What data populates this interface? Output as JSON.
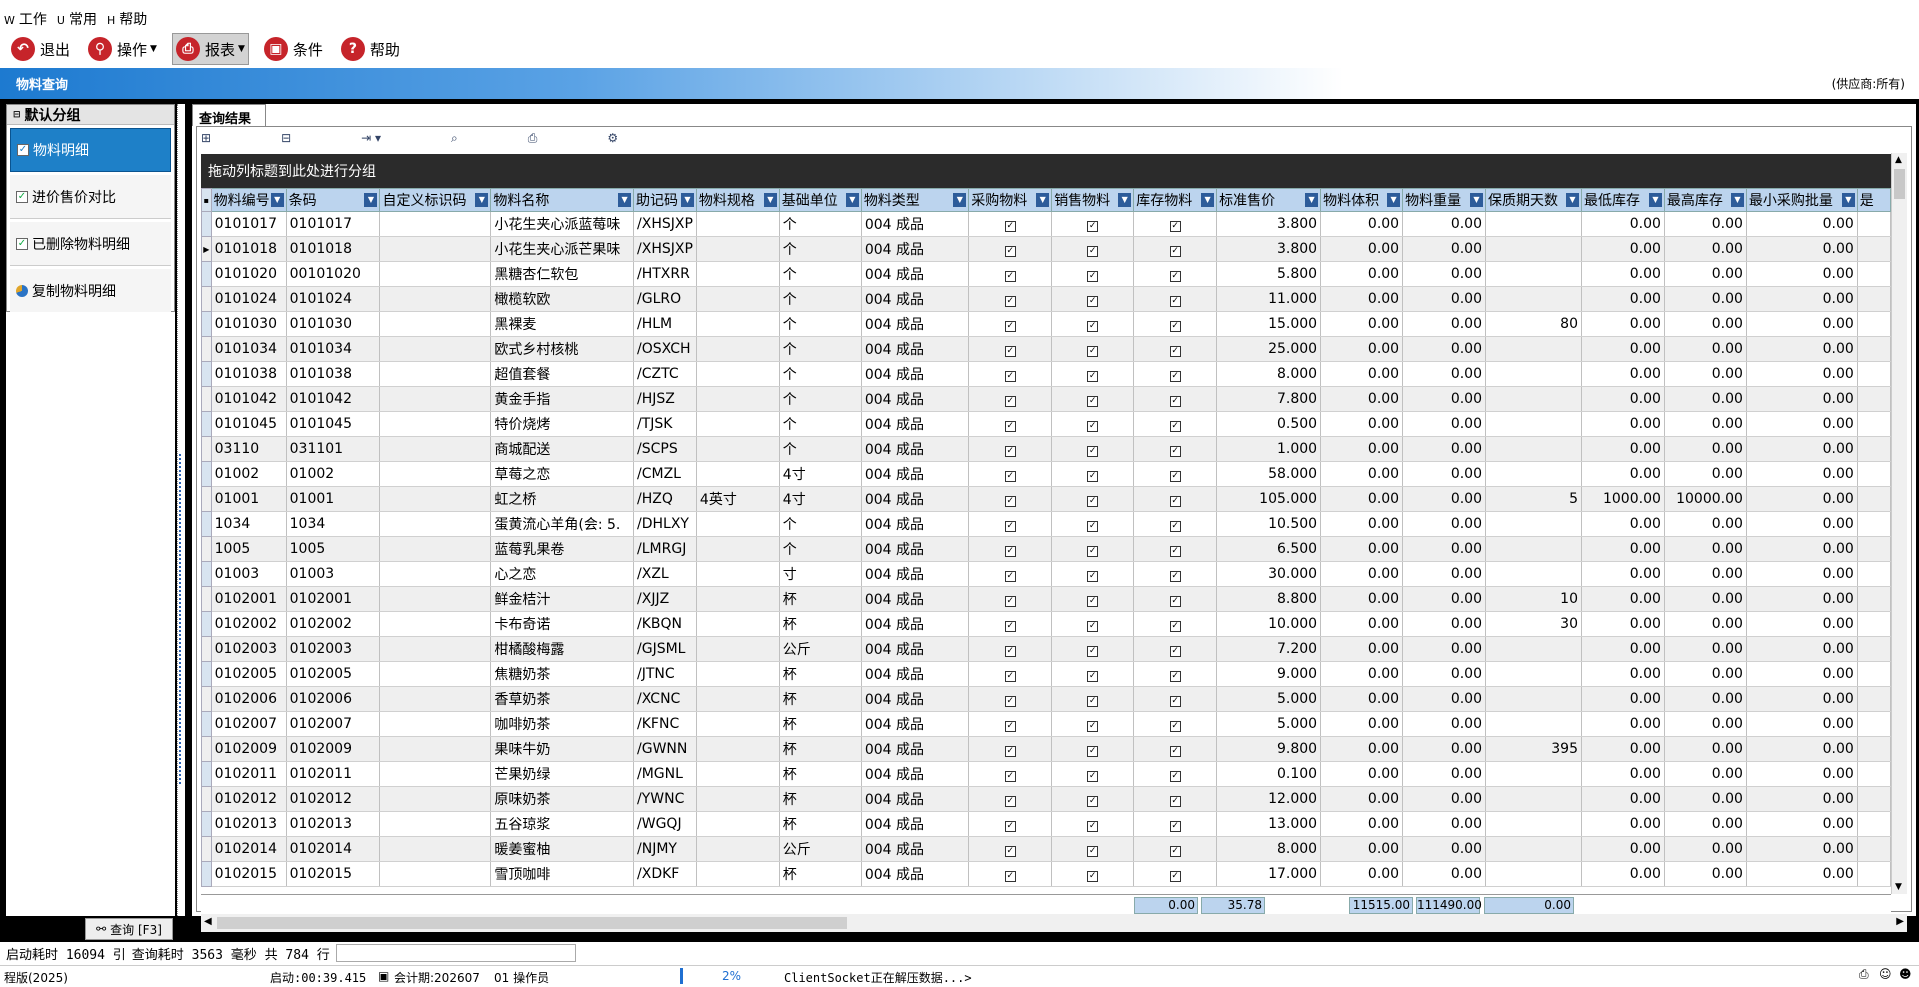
{
  "menu": {
    "items": [
      {
        "acc": "W",
        "label": "工作"
      },
      {
        "acc": "U",
        "label": "常用"
      },
      {
        "acc": "H",
        "label": "帮助"
      }
    ]
  },
  "toolbar": {
    "exit": "退出",
    "ops": "操作",
    "report": "报表",
    "cond": "条件",
    "help": "帮助"
  },
  "window": {
    "title": "物料查询",
    "supplier": "(供应商:所有)"
  },
  "left": {
    "header": "默认分组",
    "items": [
      "物料明细",
      "进价售价对比",
      "已删除物料明细",
      "复制物料明细"
    ],
    "query_button": "查询 [F3]"
  },
  "tab": "查询结果",
  "grid": {
    "group_hint": "拖动列标题到此处进行分组",
    "columns": [
      "物料编号",
      "条码",
      "自定义标识码",
      "物料名称",
      "助记码",
      "物料规格",
      "基础单位",
      "物料类型",
      "采购物料",
      "销售物料",
      "库存物料",
      "标准售价",
      "物料体积",
      "物料重量",
      "保质期天数",
      "最低库存",
      "最高库存",
      "最小采购批量",
      "是"
    ],
    "rows": [
      [
        "0101017",
        "0101017",
        "",
        "小花生夹心派蓝莓味",
        "/XHSJXP",
        "",
        "个",
        "004 成品",
        "3.800",
        "0.00",
        "0.00",
        "",
        "0.00",
        "0.00",
        "0.00"
      ],
      [
        "0101018",
        "0101018",
        "",
        "小花生夹心派芒果味",
        "/XHSJXP",
        "",
        "个",
        "004 成品",
        "3.800",
        "0.00",
        "0.00",
        "",
        "0.00",
        "0.00",
        "0.00"
      ],
      [
        "0101020",
        "00101020",
        "",
        "黑糖杏仁软包",
        "/HTXRR",
        "",
        "个",
        "004 成品",
        "5.800",
        "0.00",
        "0.00",
        "",
        "0.00",
        "0.00",
        "0.00"
      ],
      [
        "0101024",
        "0101024",
        "",
        "橄榄软欧",
        "/GLRO",
        "",
        "个",
        "004 成品",
        "11.000",
        "0.00",
        "0.00",
        "",
        "0.00",
        "0.00",
        "0.00"
      ],
      [
        "0101030",
        "0101030",
        "",
        "黑裸麦",
        "/HLM",
        "",
        "个",
        "004 成品",
        "15.000",
        "0.00",
        "0.00",
        "80",
        "0.00",
        "0.00",
        "0.00"
      ],
      [
        "0101034",
        "0101034",
        "",
        "欧式乡村核桃",
        "/OSXCH",
        "",
        "个",
        "004 成品",
        "25.000",
        "0.00",
        "0.00",
        "",
        "0.00",
        "0.00",
        "0.00"
      ],
      [
        "0101038",
        "0101038",
        "",
        "超值套餐",
        "/CZTC",
        "",
        "个",
        "004 成品",
        "8.000",
        "0.00",
        "0.00",
        "",
        "0.00",
        "0.00",
        "0.00"
      ],
      [
        "0101042",
        "0101042",
        "",
        "黄金手指",
        "/HJSZ",
        "",
        "个",
        "004 成品",
        "7.800",
        "0.00",
        "0.00",
        "",
        "0.00",
        "0.00",
        "0.00"
      ],
      [
        "0101045",
        "0101045",
        "",
        "特价烧烤",
        "/TJSK",
        "",
        "个",
        "004 成品",
        "0.500",
        "0.00",
        "0.00",
        "",
        "0.00",
        "0.00",
        "0.00"
      ],
      [
        "03110",
        "031101",
        "",
        "商城配送",
        "/SCPS",
        "",
        "个",
        "004 成品",
        "1.000",
        "0.00",
        "0.00",
        "",
        "0.00",
        "0.00",
        "0.00"
      ],
      [
        "01002",
        "01002",
        "",
        "草莓之恋",
        "/CMZL",
        "",
        "4寸",
        "004 成品",
        "58.000",
        "0.00",
        "0.00",
        "",
        "0.00",
        "0.00",
        "0.00"
      ],
      [
        "01001",
        "01001",
        "",
        "虹之桥",
        "/HZQ",
        "4英寸",
        "4寸",
        "004 成品",
        "105.000",
        "0.00",
        "0.00",
        "5",
        "1000.00",
        "10000.00",
        "0.00"
      ],
      [
        "1034",
        "1034",
        "",
        "蛋黄流心羊角(会: 5.",
        "/DHLXY",
        "",
        "个",
        "004 成品",
        "10.500",
        "0.00",
        "0.00",
        "",
        "0.00",
        "0.00",
        "0.00"
      ],
      [
        "1005",
        "1005",
        "",
        "蓝莓乳果卷",
        "/LMRGJ",
        "",
        "个",
        "004 成品",
        "6.500",
        "0.00",
        "0.00",
        "",
        "0.00",
        "0.00",
        "0.00"
      ],
      [
        "01003",
        "01003",
        "",
        "心之恋",
        "/XZL",
        "",
        "寸",
        "004 成品",
        "30.000",
        "0.00",
        "0.00",
        "",
        "0.00",
        "0.00",
        "0.00"
      ],
      [
        "0102001",
        "0102001",
        "",
        "鲜金桔汁",
        "/XJJZ",
        "",
        "杯",
        "004 成品",
        "8.800",
        "0.00",
        "0.00",
        "10",
        "0.00",
        "0.00",
        "0.00"
      ],
      [
        "0102002",
        "0102002",
        "",
        "卡布奇诺",
        "/KBQN",
        "",
        "杯",
        "004 成品",
        "10.000",
        "0.00",
        "0.00",
        "30",
        "0.00",
        "0.00",
        "0.00"
      ],
      [
        "0102003",
        "0102003",
        "",
        "柑橘酸梅露",
        "/GJSML",
        "",
        "公斤",
        "004 成品",
        "7.200",
        "0.00",
        "0.00",
        "",
        "0.00",
        "0.00",
        "0.00"
      ],
      [
        "0102005",
        "0102005",
        "",
        "焦糖奶茶",
        "/JTNC",
        "",
        "杯",
        "004 成品",
        "9.000",
        "0.00",
        "0.00",
        "",
        "0.00",
        "0.00",
        "0.00"
      ],
      [
        "0102006",
        "0102006",
        "",
        "香草奶茶",
        "/XCNC",
        "",
        "杯",
        "004 成品",
        "5.000",
        "0.00",
        "0.00",
        "",
        "0.00",
        "0.00",
        "0.00"
      ],
      [
        "0102007",
        "0102007",
        "",
        "咖啡奶茶",
        "/KFNC",
        "",
        "杯",
        "004 成品",
        "5.000",
        "0.00",
        "0.00",
        "",
        "0.00",
        "0.00",
        "0.00"
      ],
      [
        "0102009",
        "0102009",
        "",
        "果味牛奶",
        "/GWNN",
        "",
        "杯",
        "004 成品",
        "9.800",
        "0.00",
        "0.00",
        "395",
        "0.00",
        "0.00",
        "0.00"
      ],
      [
        "0102011",
        "0102011",
        "",
        "芒果奶绿",
        "/MGNL",
        "",
        "杯",
        "004 成品",
        "0.100",
        "0.00",
        "0.00",
        "",
        "0.00",
        "0.00",
        "0.00"
      ],
      [
        "0102012",
        "0102012",
        "",
        "原味奶茶",
        "/YWNC",
        "",
        "杯",
        "004 成品",
        "12.000",
        "0.00",
        "0.00",
        "",
        "0.00",
        "0.00",
        "0.00"
      ],
      [
        "0102013",
        "0102013",
        "",
        "五谷琼浆",
        "/WGQJ",
        "",
        "杯",
        "004 成品",
        "13.000",
        "0.00",
        "0.00",
        "",
        "0.00",
        "0.00",
        "0.00"
      ],
      [
        "0102014",
        "0102014",
        "",
        "暖姜蜜柚",
        "/NJMY",
        "",
        "公斤",
        "004 成品",
        "8.000",
        "0.00",
        "0.00",
        "",
        "0.00",
        "0.00",
        "0.00"
      ],
      [
        "0102015",
        "0102015",
        "",
        "雪顶咖啡",
        "/XDKF",
        "",
        "杯",
        "004 成品",
        "17.000",
        "0.00",
        "0.00",
        "",
        "0.00",
        "0.00",
        "0.00"
      ]
    ],
    "footer": {
      "volume": "0.00",
      "weight": "35.78",
      "min_stock": "11515.00",
      "max_stock": "111490.00",
      "min_batch": "0.00"
    }
  },
  "status": {
    "startup": "启动耗时 16094 引",
    "query": "查询耗时 3563 毫秒  共 784 行",
    "edition": "程版(2025)",
    "uptime": "启动:00:39.415",
    "period": "会计期:202607",
    "operator": "01 操作员",
    "percent": "2%",
    "socket": "ClientSocket正在解压数据...>"
  }
}
